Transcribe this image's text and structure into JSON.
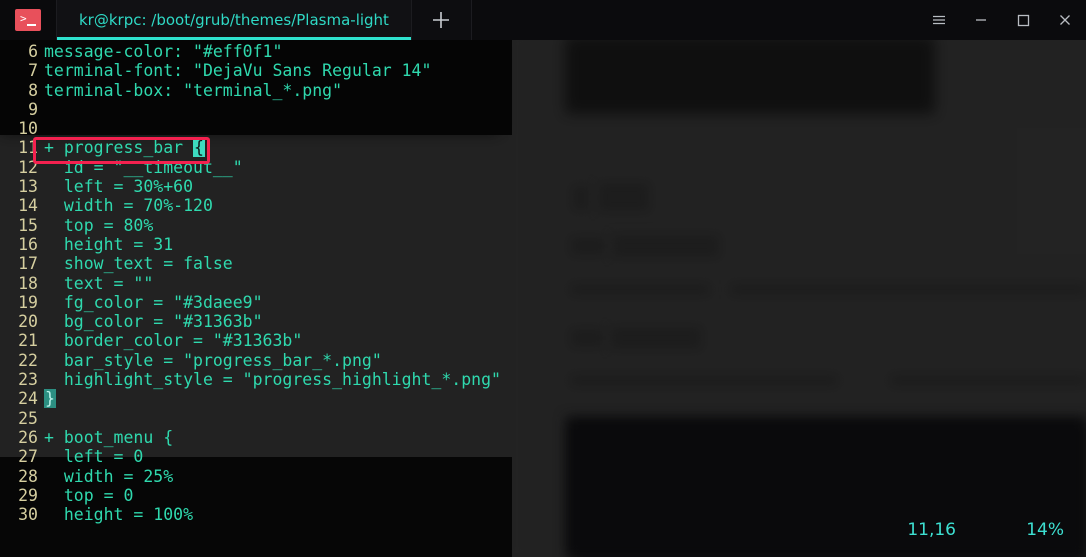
{
  "window": {
    "app_icon": "terminal-icon",
    "titlebar_buttons": [
      {
        "name": "menu-button",
        "icon": "hamburger-icon",
        "label": "☰"
      },
      {
        "name": "minimize-button",
        "icon": "minimize-icon",
        "label": "—"
      },
      {
        "name": "maximize-button",
        "icon": "maximize-icon",
        "label": "□"
      },
      {
        "name": "close-button",
        "icon": "close-icon",
        "label": "✕"
      }
    ],
    "new_tab": {
      "label": "+",
      "icon": "plus-icon"
    }
  },
  "tabs": [
    {
      "label": "kr@krpc: /boot/grub/themes/Plasma-light",
      "active": true
    }
  ],
  "editor": {
    "accent_color": "#2fe3cf",
    "text_color": "#2fd9ae",
    "line_number_color": "#d6cfa0",
    "highlight_border_color": "#f4214f",
    "cursor_color": "#3ddbc0",
    "lines": [
      {
        "num": "6",
        "text": "message-color: \"#eff0f1\""
      },
      {
        "num": "7",
        "text": "terminal-font: \"DejaVu Sans Regular 14\""
      },
      {
        "num": "8",
        "text": "terminal-box: \"terminal_*.png\""
      },
      {
        "num": "9",
        "text": ""
      },
      {
        "num": "10",
        "text": ""
      },
      {
        "num": "11",
        "text": "+ progress_bar {",
        "highlighted": true,
        "cursor_char": "{"
      },
      {
        "num": "12",
        "text": "  id = \"__timeout__\""
      },
      {
        "num": "13",
        "text": "  left = 30%+60"
      },
      {
        "num": "14",
        "text": "  width = 70%-120"
      },
      {
        "num": "15",
        "text": "  top = 80%"
      },
      {
        "num": "16",
        "text": "  height = 31"
      },
      {
        "num": "17",
        "text": "  show_text = false"
      },
      {
        "num": "18",
        "text": "  text = \"\""
      },
      {
        "num": "19",
        "text": "  fg_color = \"#3daee9\""
      },
      {
        "num": "20",
        "text": "  bg_color = \"#31363b\""
      },
      {
        "num": "21",
        "text": "  border_color = \"#31363b\""
      },
      {
        "num": "22",
        "text": "  bar_style = \"progress_bar_*.png\""
      },
      {
        "num": "23",
        "text": "  highlight_style = \"progress_highlight_*.png\""
      },
      {
        "num": "24",
        "text": "}",
        "brace_match": true
      },
      {
        "num": "25",
        "text": ""
      },
      {
        "num": "26",
        "text": "+ boot_menu {"
      },
      {
        "num": "27",
        "text": "  left = 0"
      },
      {
        "num": "28",
        "text": "  width = 25%"
      },
      {
        "num": "29",
        "text": "  top = 0"
      },
      {
        "num": "30",
        "text": "  height = 100%"
      }
    ]
  },
  "status": {
    "cursor_position": "11,16",
    "scroll_percent": "14%"
  }
}
